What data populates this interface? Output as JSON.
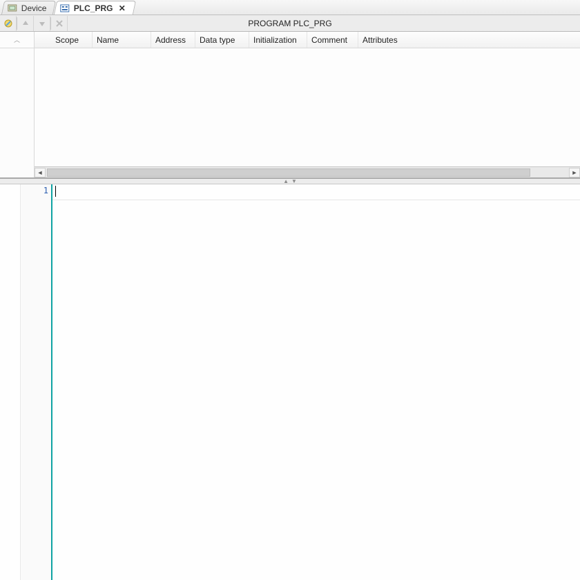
{
  "tabs": [
    {
      "label": "Device",
      "icon": "device-icon",
      "active": false
    },
    {
      "label": "PLC_PRG",
      "icon": "pou-icon",
      "active": true
    }
  ],
  "toolbar": {
    "title": "PROGRAM PLC_PRG"
  },
  "declaration": {
    "columns": {
      "scope": "Scope",
      "name": "Name",
      "address": "Address",
      "datatype": "Data type",
      "init": "Initialization",
      "comment": "Comment",
      "attributes": "Attributes"
    }
  },
  "code": {
    "first_line_number": "1"
  }
}
